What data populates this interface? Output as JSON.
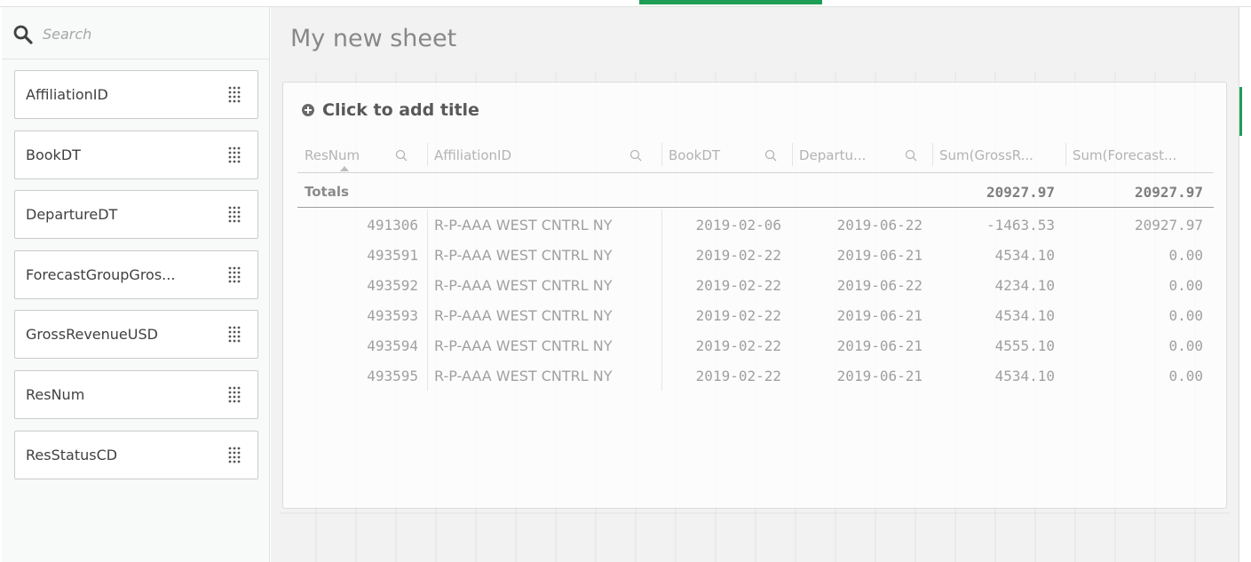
{
  "search": {
    "placeholder": "Search"
  },
  "fields": [
    {
      "label": "AffiliationID"
    },
    {
      "label": "BookDT"
    },
    {
      "label": "DepartureDT"
    },
    {
      "label": "ForecastGroupGros..."
    },
    {
      "label": "GrossRevenueUSD"
    },
    {
      "label": "ResNum"
    },
    {
      "label": "ResStatusCD"
    }
  ],
  "sheet": {
    "title": "My new sheet"
  },
  "table": {
    "title_placeholder": "Click to add title",
    "columns": [
      "ResNum",
      "AffiliationID",
      "BookDT",
      "Departu...",
      "Sum(GrossR...",
      "Sum(Forecast..."
    ],
    "totals_label": "Totals",
    "totals": {
      "gross": "20927.97",
      "forecast": "20927.97"
    },
    "rows": [
      {
        "resnum": "491306",
        "affiliation": "R-P-AAA WEST CNTRL NY",
        "book": "2019-02-06",
        "departure": "2019-06-22",
        "gross": "-1463.53",
        "forecast": "20927.97"
      },
      {
        "resnum": "493591",
        "affiliation": "R-P-AAA WEST CNTRL NY",
        "book": "2019-02-22",
        "departure": "2019-06-21",
        "gross": "4534.10",
        "forecast": "0.00"
      },
      {
        "resnum": "493592",
        "affiliation": "R-P-AAA WEST CNTRL NY",
        "book": "2019-02-22",
        "departure": "2019-06-22",
        "gross": "4234.10",
        "forecast": "0.00"
      },
      {
        "resnum": "493593",
        "affiliation": "R-P-AAA WEST CNTRL NY",
        "book": "2019-02-22",
        "departure": "2019-06-21",
        "gross": "4534.10",
        "forecast": "0.00"
      },
      {
        "resnum": "493594",
        "affiliation": "R-P-AAA WEST CNTRL NY",
        "book": "2019-02-22",
        "departure": "2019-06-21",
        "gross": "4555.10",
        "forecast": "0.00"
      },
      {
        "resnum": "493595",
        "affiliation": "R-P-AAA WEST CNTRL NY",
        "book": "2019-02-22",
        "departure": "2019-06-21",
        "gross": "4534.10",
        "forecast": "0.00"
      }
    ]
  },
  "colors": {
    "accent": "#1e9e55"
  }
}
